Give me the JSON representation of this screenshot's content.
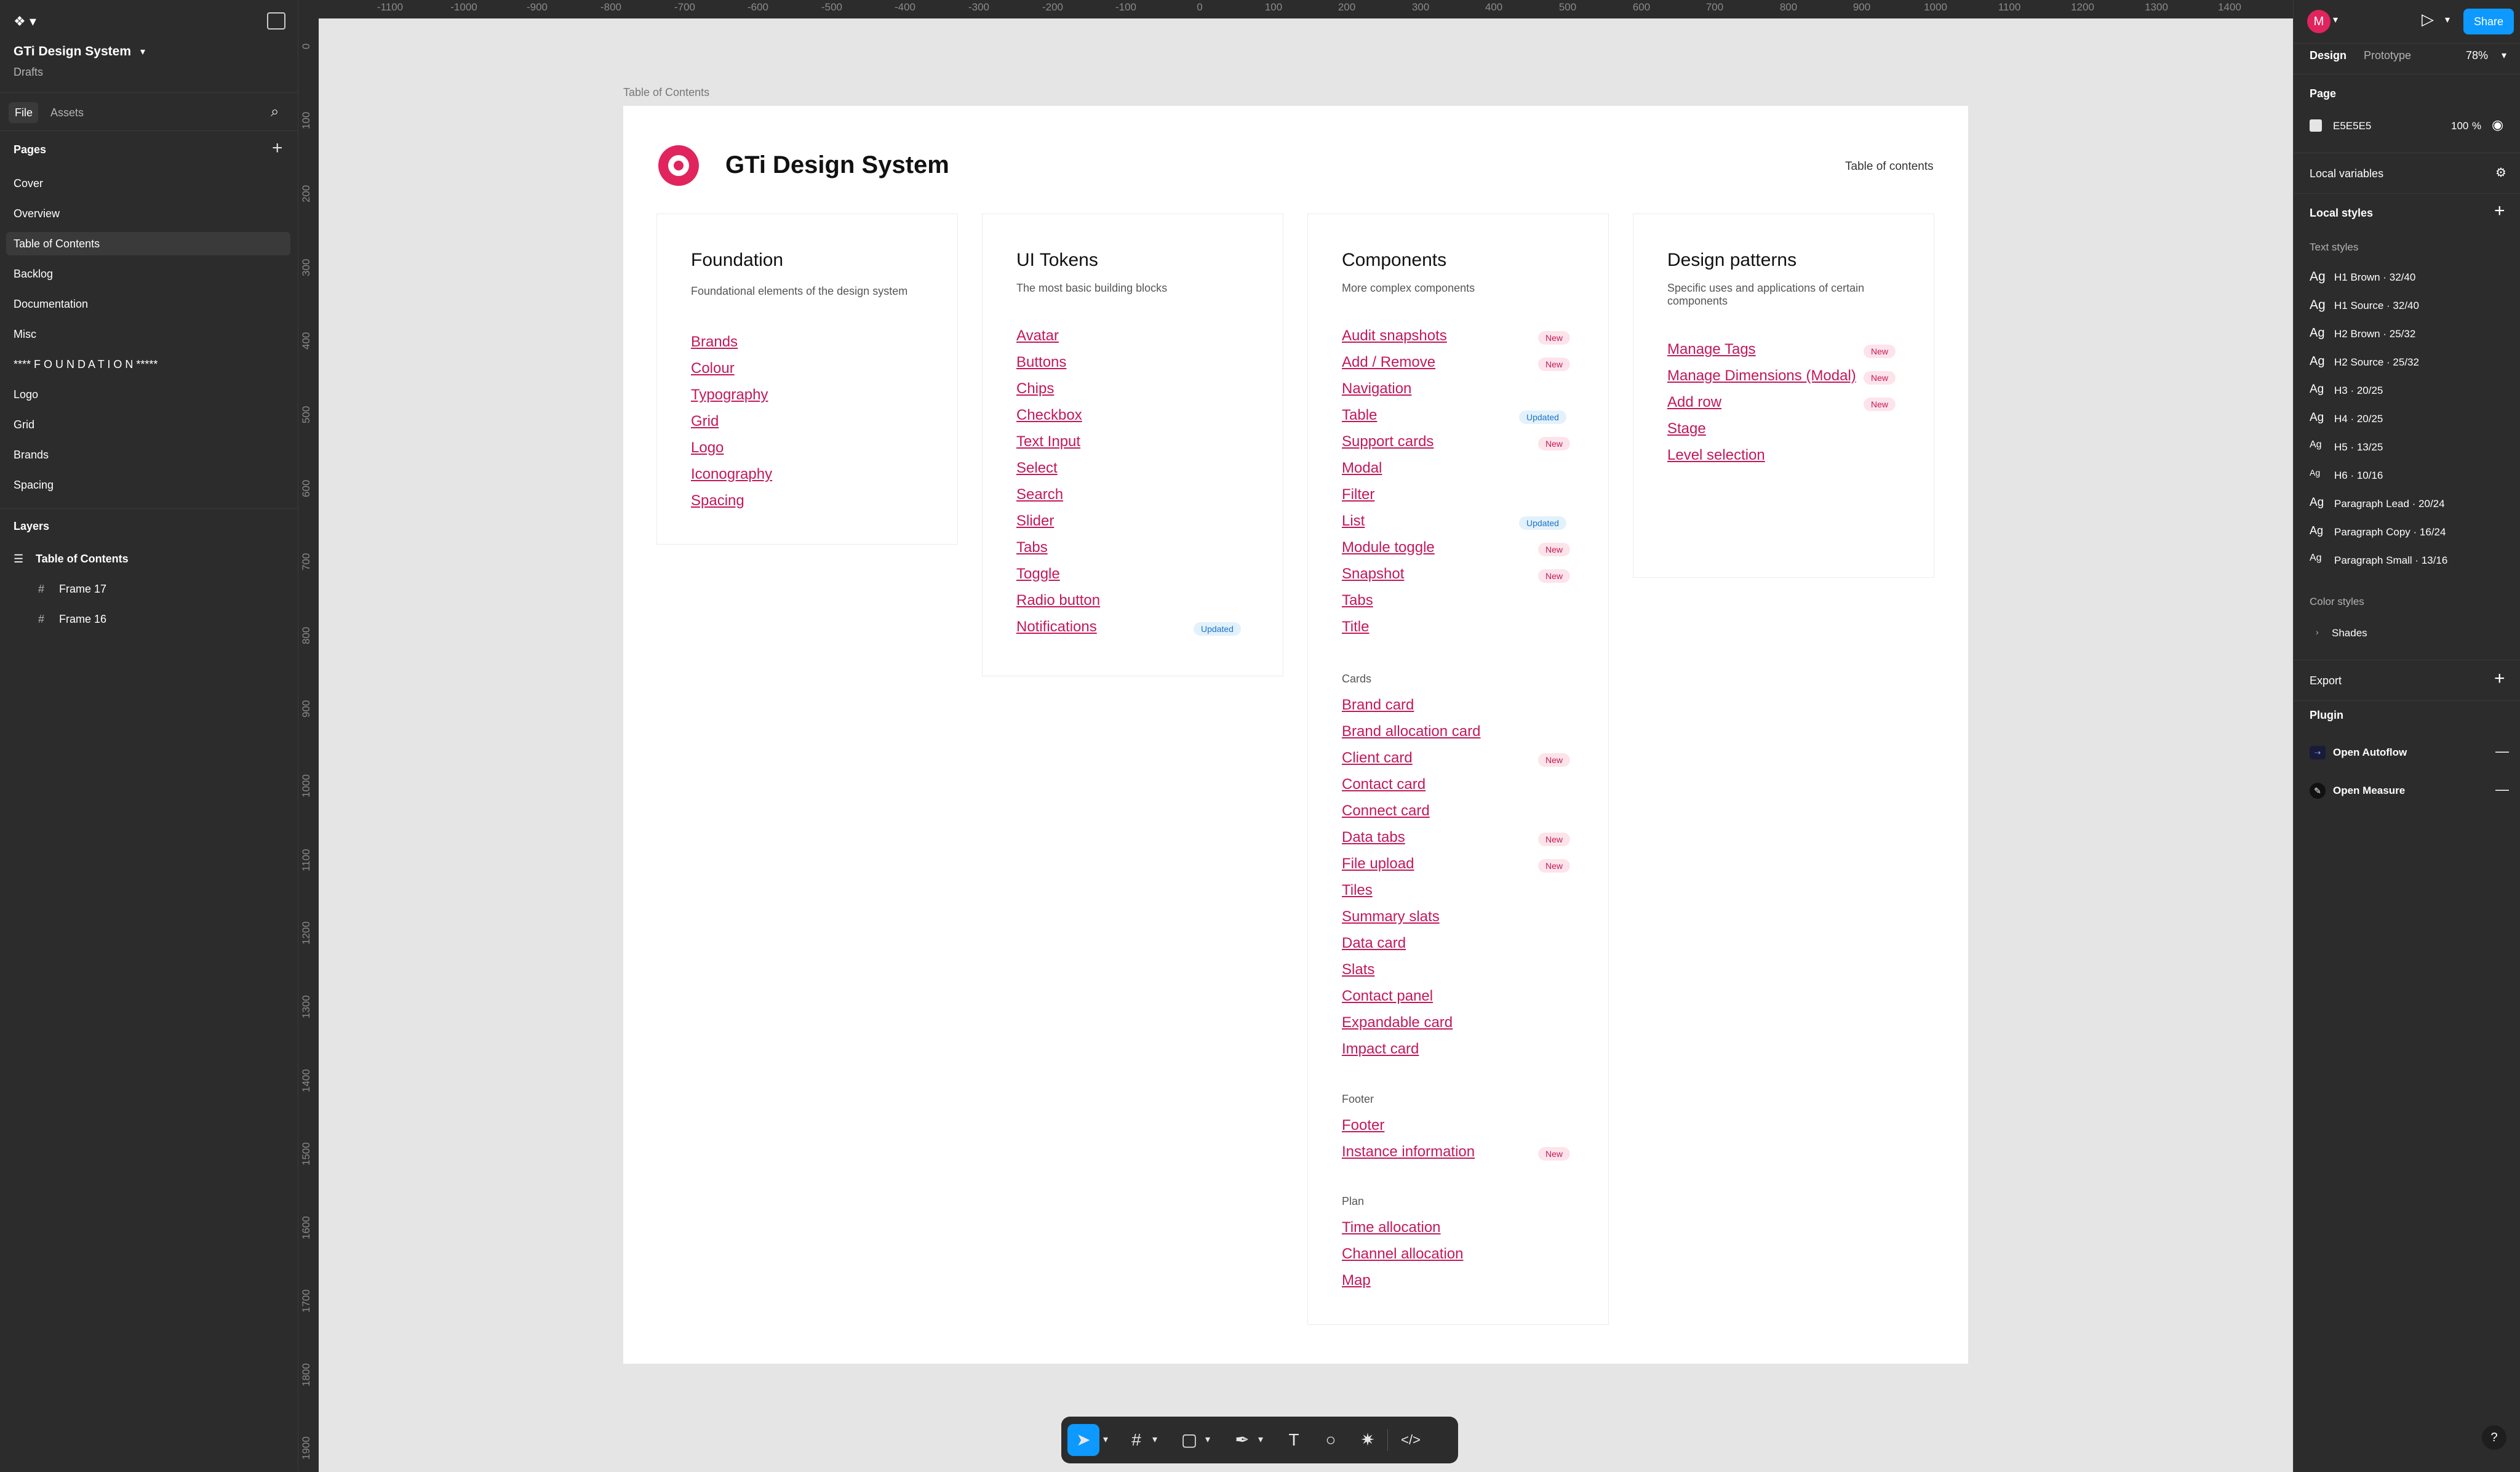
{
  "file": {
    "title": "GTi Design System",
    "subtitle": "Drafts"
  },
  "left_tabs": {
    "file": "File",
    "assets": "Assets"
  },
  "pages": {
    "heading": "Pages",
    "items": [
      "Cover",
      "Overview",
      "Table of Contents",
      "Backlog",
      "Documentation",
      "Misc",
      "**** F O U N D A T I O N *****",
      "Logo",
      "Grid",
      "Brands",
      "Spacing"
    ]
  },
  "layers": {
    "heading": "Layers",
    "root": "Table of Contents",
    "children": [
      "Frame 17",
      "Frame 16"
    ]
  },
  "ruler": {
    "x": [
      "-1100",
      "-1000",
      "-900",
      "-800",
      "-700",
      "-600",
      "-500",
      "-400",
      "-300",
      "-200",
      "-100",
      "0",
      "100",
      "200",
      "300",
      "400",
      "500",
      "600",
      "700",
      "800",
      "900",
      "1000",
      "1100",
      "1200",
      "1300",
      "1400"
    ],
    "y": [
      "0",
      "100",
      "200",
      "300",
      "400",
      "500",
      "600",
      "700",
      "800",
      "900",
      "1000",
      "1100",
      "1200",
      "1300",
      "1400",
      "1500",
      "1600",
      "1700",
      "1800",
      "1900"
    ]
  },
  "frame": {
    "label": "Table of Contents",
    "title": "GTi Design System",
    "toc": "Table of contents"
  },
  "cards": {
    "foundation": {
      "title": "Foundation",
      "desc": "Foundational elements of the design system",
      "links": [
        "Brands",
        "Colour",
        "Typography",
        "Grid",
        "Logo",
        "Iconography",
        "Spacing"
      ]
    },
    "tokens": {
      "title": "UI Tokens",
      "desc": "The most basic building blocks",
      "links": [
        "Avatar",
        "Buttons",
        "Chips",
        "Checkbox",
        "Text Input",
        "Select",
        "Search",
        "Slider",
        "Tabs",
        "Toggle",
        "Radio button",
        "Notifications"
      ],
      "notif_tag": "Updated"
    },
    "components": {
      "title": "Components",
      "desc": "More complex components",
      "links": [
        "Audit snapshots",
        "Add / Remove",
        "Navigation",
        "Table",
        "Support cards",
        "Modal",
        "Filter",
        "List",
        "Module toggle",
        "Snapshot",
        "Tabs",
        "Title"
      ],
      "tags": [
        "New",
        "New",
        "",
        "Updated",
        "New",
        "",
        "",
        "Updated",
        "New",
        "New",
        "",
        ""
      ],
      "cards_heading": "Cards",
      "cards_links": [
        "Brand card",
        "Brand allocation card",
        "Client card",
        "Contact card",
        "Connect card",
        "Data tabs",
        "File upload",
        "Tiles",
        "Summary slats",
        "Data card",
        "Slats",
        "Contact panel",
        "Expandable card",
        "Impact card"
      ],
      "cards_tags": [
        "",
        "",
        "New",
        "",
        "",
        "New",
        "New",
        "",
        "",
        "",
        "",
        "",
        "",
        ""
      ],
      "footer_heading": "Footer",
      "footer_links": [
        "Footer",
        "Instance information"
      ],
      "footer_tags": [
        "",
        "New"
      ],
      "plan_heading": "Plan",
      "plan_links": [
        "Time allocation",
        "Channel allocation",
        "Map"
      ]
    },
    "patterns": {
      "title": "Design patterns",
      "desc": "Specific uses and applications of certain components",
      "links": [
        "Manage Tags",
        "Manage Dimensions (Modal)",
        "Add row",
        "Stage",
        "Level selection"
      ],
      "tags": [
        "New",
        "New",
        "New",
        "",
        ""
      ]
    }
  },
  "right": {
    "avatar": "M",
    "share": "Share",
    "tab_design": "Design",
    "tab_prototype": "Prototype",
    "zoom": "78%",
    "page_heading": "Page",
    "bg_hex": "E5E5E5",
    "bg_opacity": "100",
    "pct": "%",
    "local_vars": "Local variables",
    "local_styles": "Local styles",
    "text_styles": "Text styles",
    "styles": [
      [
        "Ag",
        "H1 Brown · 32/40"
      ],
      [
        "Ag",
        "H1 Source · 32/40"
      ],
      [
        "Ag",
        "H2 Brown · 25/32"
      ],
      [
        "Ag",
        "H2 Source · 25/32"
      ],
      [
        "Ag",
        "H3 · 20/25"
      ],
      [
        "Ag",
        "H4 · 20/25"
      ],
      [
        "Ag",
        "H5 · 13/25"
      ],
      [
        "Ag",
        "H6 · 10/16"
      ],
      [
        "Ag",
        "Paragraph Lead · 20/24"
      ],
      [
        "Ag",
        "Paragraph Copy · 16/24"
      ],
      [
        "Ag",
        "Paragraph Small · 13/16"
      ]
    ],
    "color_styles": "Color styles",
    "shades": "Shades",
    "export": "Export",
    "plugin": "Plugin",
    "plugins": [
      "Open Autoflow",
      "Open Measure"
    ],
    "help": "?"
  },
  "colors": {
    "accent": "#0d99ff",
    "link": "#c2185b",
    "bg": "#e5e5e5"
  }
}
